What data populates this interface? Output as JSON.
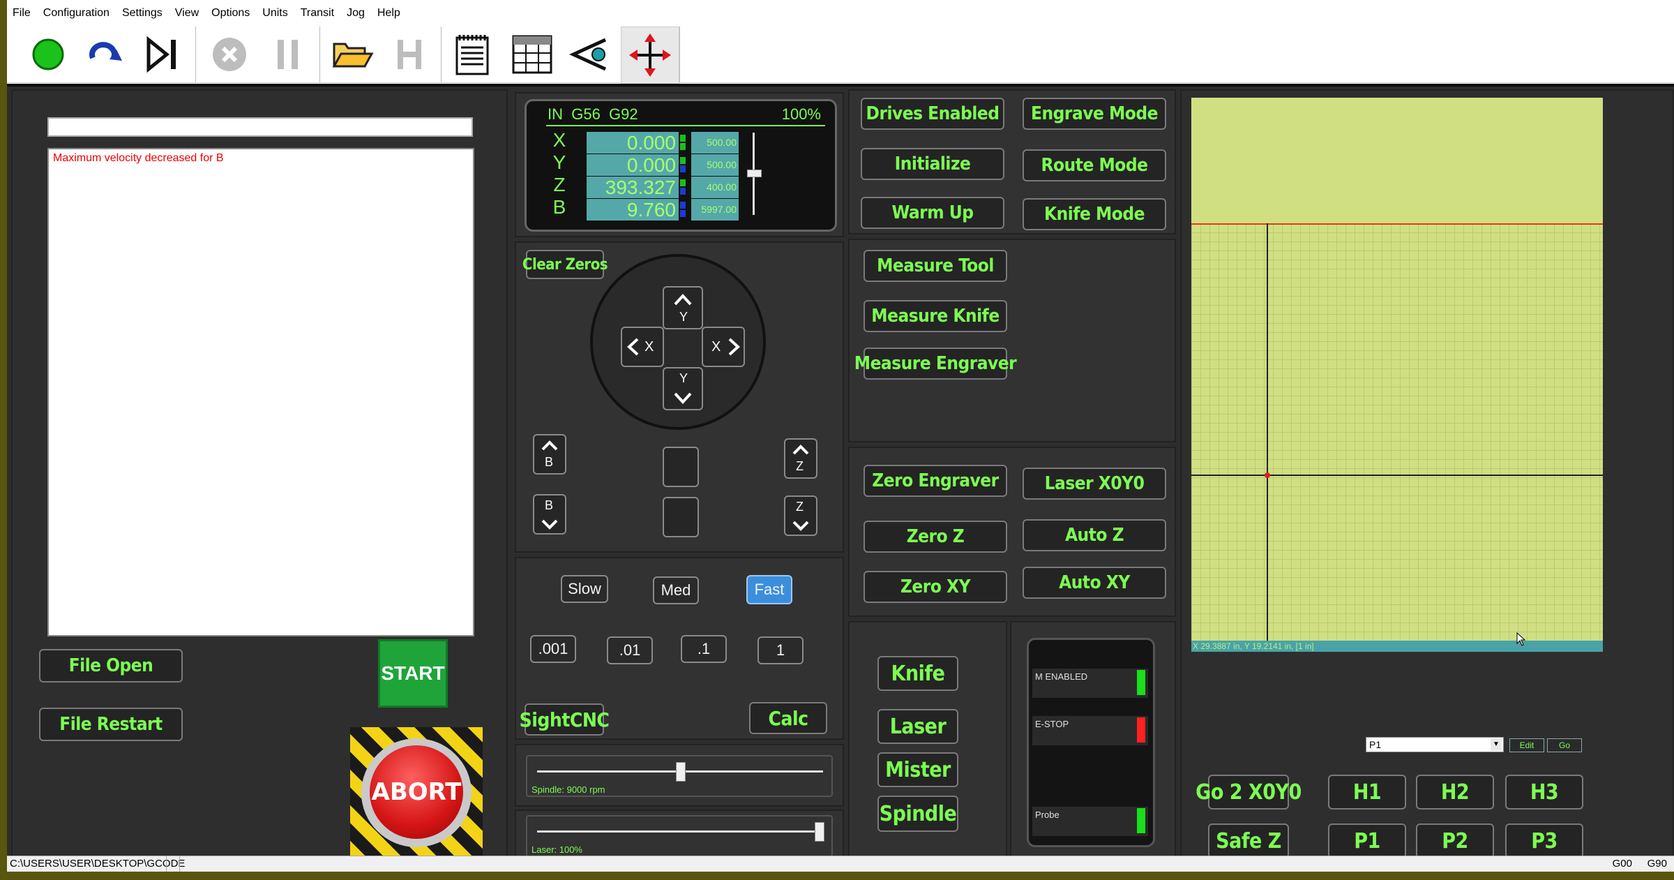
{
  "menu": [
    "File",
    "Configuration",
    "Settings",
    "View",
    "Options",
    "Units",
    "Transit",
    "Jog",
    "Help"
  ],
  "toolbar": [
    "start-icon",
    "redo-icon",
    "step-icon",
    "stop-icon",
    "pause-icon",
    "open-folder-icon",
    "home-icon",
    "gcode-list-icon",
    "calculator-icon",
    "eye-icon",
    "jog-move-icon"
  ],
  "log": {
    "input_value": "",
    "message": "Maximum velocity decreased for B"
  },
  "left_buttons": {
    "file_open": "File Open",
    "file_restart": "File Restart",
    "start": "START",
    "abort": "ABORT"
  },
  "dro": {
    "mode": "IN  G56  G92",
    "percent": "100%",
    "axes": [
      {
        "name": "X",
        "value": "0.000",
        "feed": "500.00"
      },
      {
        "name": "Y",
        "value": "0.000",
        "feed": "500.00"
      },
      {
        "name": "Z",
        "value": "393.327",
        "feed": "400.00"
      },
      {
        "name": "B",
        "value": "9.760",
        "feed": "5997.00"
      }
    ]
  },
  "jog": {
    "clear_zeros": "Clear Zeros",
    "y": "Y",
    "x": "X",
    "b": "B",
    "z": "Z"
  },
  "speed": {
    "slow": "Slow",
    "med": "Med",
    "fast": "Fast",
    "increments": [
      ".001",
      ".01",
      ".1",
      "1"
    ],
    "sightcnc": "SightCNC",
    "calc": "Calc"
  },
  "spindle": {
    "label": "Spindle: 9000 rpm",
    "level": 0.5
  },
  "laser": {
    "label": "Laser: 100%",
    "level": 1.0
  },
  "modes": {
    "drives_enabled": "Drives Enabled",
    "engrave_mode": "Engrave Mode",
    "initialize": "Initialize",
    "route_mode": "Route Mode",
    "warm_up": "Warm Up",
    "knife_mode": "Knife Mode"
  },
  "measure": {
    "tool": "Measure Tool",
    "knife": "Measure Knife",
    "engraver": "Measure Engraver"
  },
  "zero": {
    "engraver": "Zero Engraver",
    "laser_xy": "Laser X0Y0",
    "z": "Zero Z",
    "auto_z": "Auto Z",
    "xy": "Zero XY",
    "auto_xy": "Auto XY"
  },
  "outputs": {
    "knife": "Knife",
    "laser": "Laser",
    "mister": "Mister",
    "spindle": "Spindle"
  },
  "leds": [
    {
      "label": "M ENABLED",
      "color": "#19e019"
    },
    {
      "label": "E-STOP",
      "color": "#ff2020"
    },
    {
      "label": "Probe",
      "color": "#19e019"
    }
  ],
  "preview": {
    "coords": "X 29.3887 in, Y 19.2141 in, [1 in]"
  },
  "position": {
    "select": "P1",
    "edit": "Edit",
    "go": "Go"
  },
  "goto": {
    "go2xy0": "Go 2 X0Y0",
    "safe_z": "Safe Z",
    "h1": "H1",
    "h2": "H2",
    "h3": "H3",
    "p1": "P1",
    "p2": "P2",
    "p3": "P3"
  },
  "status": {
    "path": "C:\\USERS\\USER\\DESKTOP\\GCODE",
    "g0": "G00",
    "g90": "G90"
  },
  "colors": {
    "green_text": "#7cfd52",
    "preview_bg": "#d0df82"
  }
}
